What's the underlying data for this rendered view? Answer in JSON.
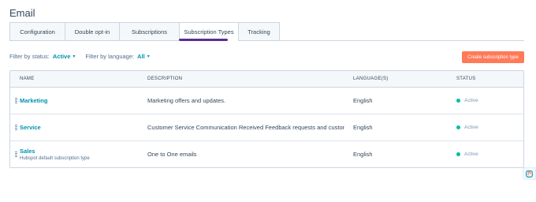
{
  "page": {
    "title": "Email"
  },
  "tabs": [
    {
      "label": "Configuration",
      "active": false
    },
    {
      "label": "Double opt-in",
      "active": false
    },
    {
      "label": "Subscriptions",
      "active": false
    },
    {
      "label": "Subscription Types",
      "active": true
    },
    {
      "label": "Tracking",
      "active": false
    }
  ],
  "filters": {
    "status_label": "Filter by status:",
    "status_value": "Active",
    "language_label": "Filter by language:",
    "language_value": "All"
  },
  "create_button": {
    "label": "Create subscription type"
  },
  "table": {
    "headers": {
      "name": "NAME",
      "description": "DESCRIPTION",
      "language": "LANGUAGE(S)",
      "status": "STATUS"
    },
    "rows": [
      {
        "name": "Marketing",
        "subtitle": "",
        "description": "Marketing offers and updates.",
        "language": "English",
        "status": "Active"
      },
      {
        "name": "Service",
        "subtitle": "",
        "description": "Customer Service Communication Received Feedback requests and custome...",
        "language": "English",
        "status": "Active"
      },
      {
        "name": "Sales",
        "subtitle": "Hubspot default subscription type",
        "description": "One to One emails",
        "language": "English",
        "status": "Active"
      }
    ]
  },
  "colors": {
    "accent": "#0091ae",
    "primary_button": "#ff7a59",
    "tab_underline": "#5c2d91",
    "status_active": "#00bda5"
  },
  "icons": {
    "help": "help-widget-icon",
    "drag": "drag-handle-icon",
    "caret": "chevron-down-icon"
  }
}
